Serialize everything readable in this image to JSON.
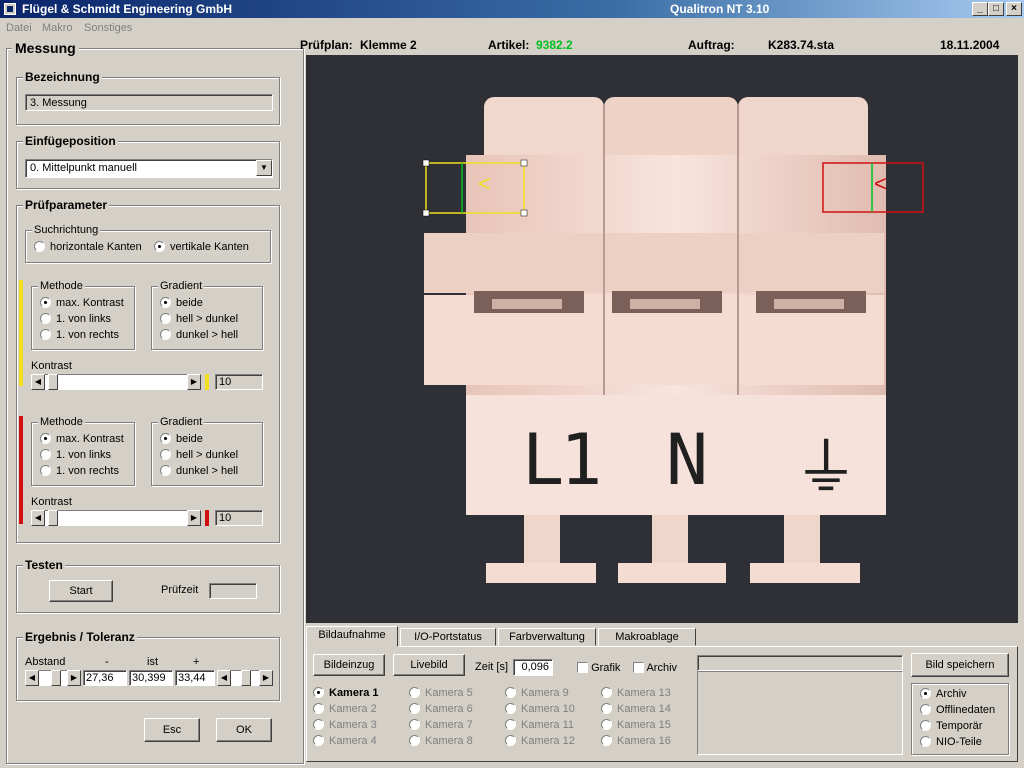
{
  "window": {
    "title_left": "Flügel & Schmidt  Engineering GmbH",
    "title_center": "Qualitron NT  3.10",
    "btn_min": "_",
    "btn_max": "□",
    "btn_close": "×"
  },
  "menu": [
    "Datei",
    "Makro",
    "Sonstiges"
  ],
  "info": {
    "pruefplan_label": "Prüfplan:",
    "pruefplan_value": "Klemme 2",
    "artikel_label": "Artikel:",
    "artikel_value": "9382.2",
    "auftrag_label": "Auftrag:",
    "auftrag_value": "K283.74.sta",
    "date": "18.11.2004"
  },
  "left": {
    "panel_title": "Messung",
    "bezeichnung": {
      "title": "Bezeichnung",
      "value": "3. Messung"
    },
    "einfuege": {
      "title": "Einfügeposition",
      "value": "0.  Mittelpunkt manuell"
    },
    "pruefparameter": {
      "title": "Prüfparameter",
      "suchrichtung": {
        "title": "Suchrichtung",
        "horizontal": "horizontale Kanten",
        "vertikal": "vertikale Kanten"
      },
      "yellow": {
        "methode_title": "Methode",
        "m1": "max. Kontrast",
        "m2": "1. von links",
        "m3": "1. von rechts",
        "gradient_title": "Gradient",
        "g1": "beide",
        "g2": "hell > dunkel",
        "g3": "dunkel > hell",
        "kontrast_label": "Kontrast",
        "kontrast_value": "10",
        "slider_pos": 0.02
      },
      "red": {
        "methode_title": "Methode",
        "m1": "max. Kontrast",
        "m2": "1. von links",
        "m3": "1. von rechts",
        "gradient_title": "Gradient",
        "g1": "beide",
        "g2": "hell > dunkel",
        "g3": "dunkel > hell",
        "kontrast_label": "Kontrast",
        "kontrast_value": "10",
        "slider_pos": 0.02
      }
    },
    "testen": {
      "title": "Testen",
      "start": "Start",
      "pruefzeit_label": "Prüfzeit",
      "pruefzeit_value": ""
    },
    "ergebnis": {
      "title": "Ergebnis / Toleranz",
      "abstand": "Abstand",
      "minus": "-",
      "ist": "ist",
      "plus": "+",
      "min_value": "27,36",
      "ist_value": "30,399",
      "max_value": "33,44"
    },
    "esc": "Esc",
    "ok": "OK"
  },
  "image": {
    "labels": [
      "L1",
      "N",
      "⏚"
    ],
    "marker_glyph": "<"
  },
  "bottom": {
    "tabs": [
      "Bildaufnahme",
      "I/O-Portstatus",
      "Farbverwaltung",
      "Makroablage"
    ],
    "bildeinzug": "Bildeinzug",
    "livebild": "Livebild",
    "zeit_label": "Zeit [s]",
    "zeit_value": "0,096",
    "grafik": "Grafik",
    "archiv_chk": "Archiv",
    "bild_speichern": "Bild speichern",
    "cameras": [
      "Kamera 1",
      "Kamera 2",
      "Kamera 3",
      "Kamera 4",
      "Kamera 5",
      "Kamera 6",
      "Kamera 7",
      "Kamera 8",
      "Kamera 9",
      "Kamera 10",
      "Kamera 11",
      "Kamera 12",
      "Kamera 13",
      "Kamera 14",
      "Kamera 15",
      "Kamera 16"
    ],
    "save_options": [
      "Archiv",
      "Offlinedaten",
      "Temporär",
      "NIO-Teile"
    ]
  },
  "colors": {
    "yellow": "#f0e020",
    "red": "#d01010",
    "green": "#00c020",
    "title_dark": "#0a246a"
  }
}
